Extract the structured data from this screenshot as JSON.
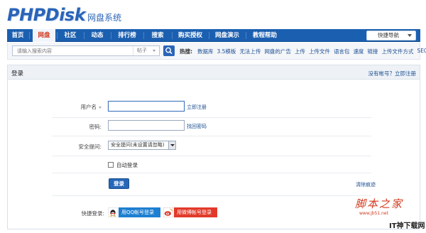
{
  "logo": {
    "main": "PHPDisk",
    "sub": "网盘系统"
  },
  "nav": {
    "items": [
      "首页",
      "网盘",
      "社区",
      "动态",
      "排行榜",
      "搜索",
      "购买授权",
      "网盘演示",
      "教程帮助"
    ],
    "active": "网盘",
    "quick": "快捷导航"
  },
  "search": {
    "placeholder": "请输入搜索内容",
    "type": "帖子",
    "hot_label": "热搜:",
    "hot_links": [
      "数据库",
      "3.5模板",
      "无法上传",
      "网盘的广告",
      "上传",
      "上传文件",
      "语言包",
      "速度",
      "链接",
      "上传文件方式",
      "SEO"
    ]
  },
  "panel": {
    "title": "登录",
    "register_prompt": "没有帐号？立即注册",
    "username_label": "用户名",
    "register_link": "立即注册",
    "password_label": "密码:",
    "forgot_link": "找回密码",
    "question_label": "安全提问:",
    "question_value": "安全提问(未设置请忽略)",
    "auto_login": "自动登录",
    "login_button": "登录",
    "clear_link": "清除痕迹",
    "quick_label": "快捷登录:",
    "qq_login": "用QQ帐号登录",
    "weibo_login": "用微博帐号登录"
  },
  "watermarks": {
    "jb51": "脚本之家",
    "jb51_url": "www.jb51.net",
    "site": "IT神下载网"
  },
  "colors": {
    "brand": "#2a64b8",
    "nav": "#1b5fb0",
    "active": "#d23a1d",
    "qq": "#1e7fd0",
    "weibo": "#e23a2a"
  }
}
